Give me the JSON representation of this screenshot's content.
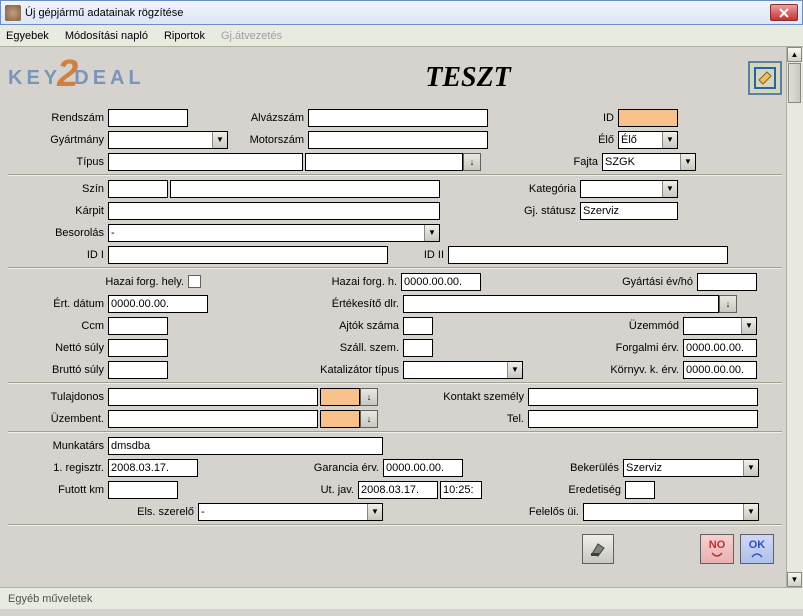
{
  "window": {
    "title": "Új gépjármű adatainak rögzítése"
  },
  "menu": {
    "items": [
      "Egyebek",
      "Módosítási napló",
      "Riportok",
      "Gj.átvezetés"
    ],
    "disabled": [
      false,
      false,
      false,
      true
    ]
  },
  "header": {
    "logo_key": "KEY",
    "logo_deal": "DEAL",
    "title": "TESZT"
  },
  "labels": {
    "rendszam": "Rendszám",
    "alvazszam": "Alvázszám",
    "id": "ID",
    "gyartmany": "Gyártmány",
    "motorszam": "Motorszám",
    "elo": "Élő",
    "tipus": "Típus",
    "fajta": "Fajta",
    "szin": "Szín",
    "kategoria": "Kategória",
    "karpit": "Kárpit",
    "gjstatusz": "Gj. státusz",
    "besorolas": "Besorolás",
    "id1": "ID I",
    "id2": "ID II",
    "hazai_hely": "Hazai forg. hely.",
    "hazai_h": "Hazai forg. h.",
    "gyartasi": "Gyártási év/hó",
    "ert_datum": "Ért. dátum",
    "ert_dlr": "Értékesítő dlr.",
    "ccm": "Ccm",
    "ajtok": "Ajtók száma",
    "uzemmod": "Üzemmód",
    "netto": "Nettó súly",
    "szall": "Száll. szem.",
    "forgalmi": "Forgalmi érv.",
    "brutto": "Bruttó súly",
    "kat_tipus": "Katalizátor típus",
    "kornyv": "Környv. k. érv.",
    "tulajdonos": "Tulajdonos",
    "kontakt": "Kontakt személy",
    "uzembent": "Üzembent.",
    "tel": "Tel.",
    "munkatars": "Munkatárs",
    "regisztr1": "1. regisztr.",
    "garancia": "Garancia érv.",
    "bekerules": "Bekerülés",
    "futott": "Futott km",
    "utjav": "Ut. jav.",
    "eredetiseg": "Eredetiség",
    "els_szerelo": "Els. szerelő",
    "felelos": "Felelős üi."
  },
  "values": {
    "elo": "Élő",
    "fajta": "SZGK",
    "gjstatusz": "Szerviz",
    "besorolas": "-",
    "hazai_h": "0000.00.00.",
    "ert_datum": "0000.00.00.",
    "forgalmi": "0000.00.00.",
    "kornyv": "0000.00.00.",
    "munkatars": "dmsdba",
    "regisztr1": "2008.03.17.",
    "garancia": "0000.00.00.",
    "bekerules": "Szerviz",
    "utjav_date": "2008.03.17.",
    "utjav_time": "10:25:",
    "els_szerelo": "-"
  },
  "buttons": {
    "no": "NO",
    "ok": "OK"
  },
  "status": "Egyéb műveletek"
}
